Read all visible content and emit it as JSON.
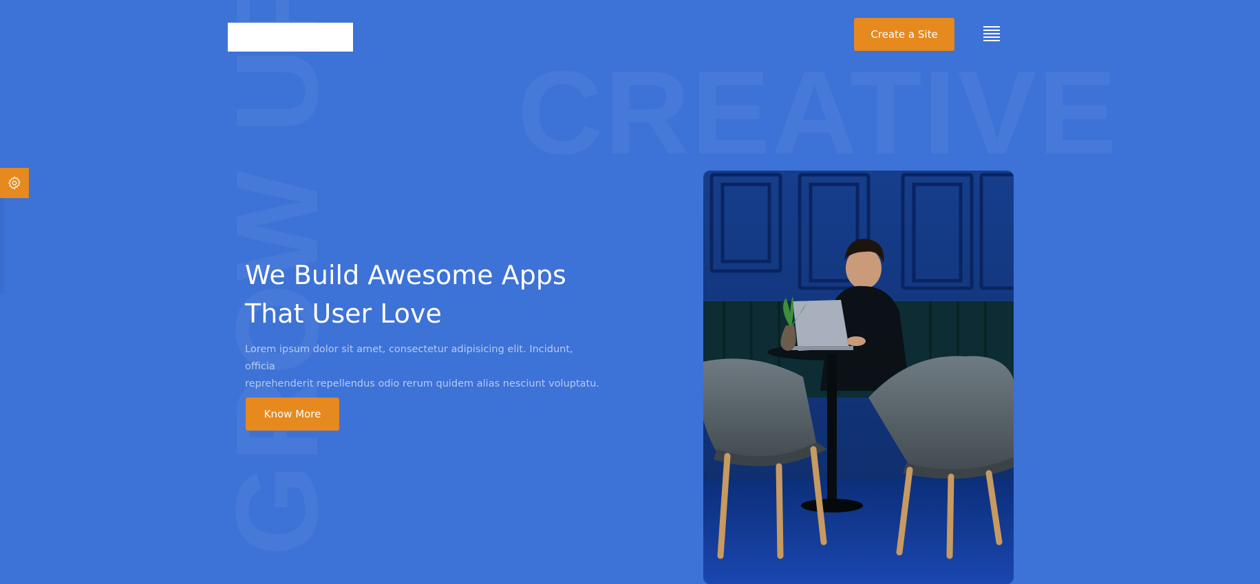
{
  "background_words": {
    "vertical": "GROW UP",
    "horizontal": "CREATIVE"
  },
  "header": {
    "cta_label": "Create a Site"
  },
  "hero": {
    "title_line1": "We Build Awesome Apps",
    "title_line2": "That User Love",
    "description_line1": "Lorem ipsum dolor sit amet, consectetur adipisicing elit. Incidunt, officia",
    "description_line2": "reprehenderit repellendus odio rerum quidem alias nesciunt voluptatu.",
    "button_label": "Know More"
  },
  "icons": {
    "menu": "hamburger-icon",
    "settings": "gear-icon"
  },
  "colors": {
    "background": "#3d72d6",
    "accent": "#e6891e",
    "text": "#ffffff"
  }
}
